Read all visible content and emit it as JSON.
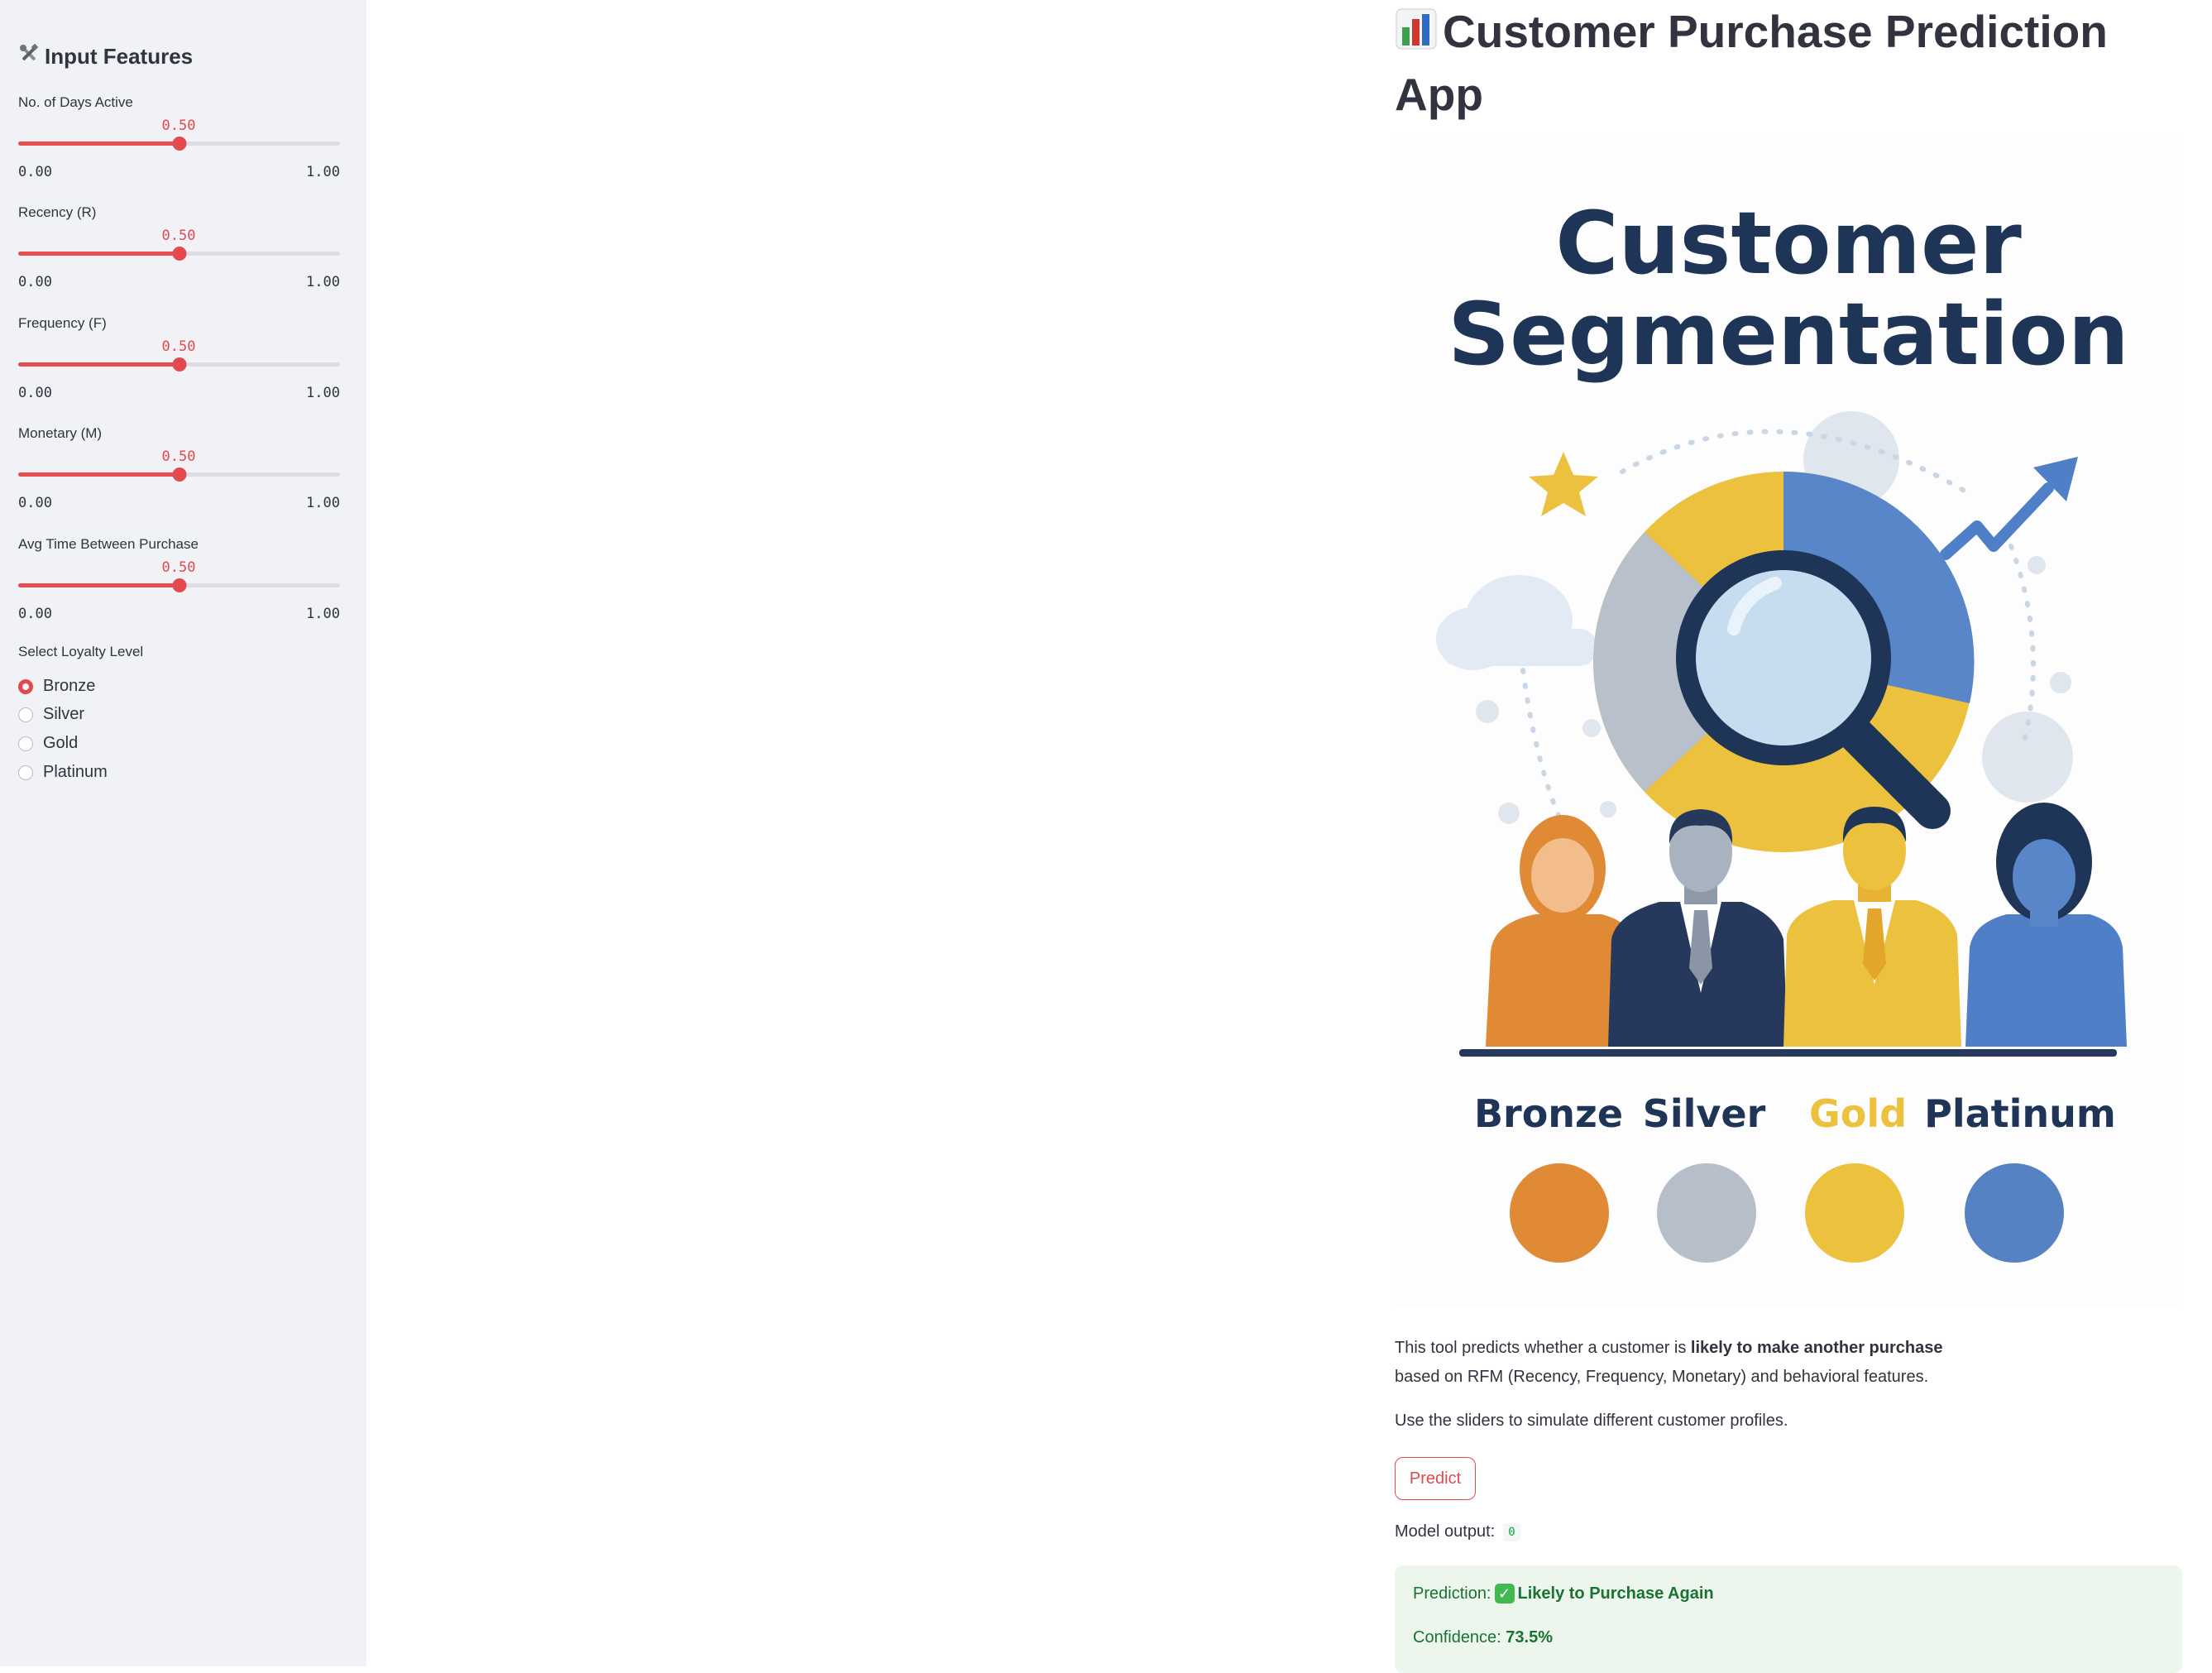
{
  "sidebar": {
    "title": "Input Features",
    "title_icon": "tools-icon",
    "sliders": [
      {
        "label": "No. of Days Active",
        "value": "0.50",
        "min": "0.00",
        "max": "1.00",
        "fraction": 0.5
      },
      {
        "label": "Recency (R)",
        "value": "0.50",
        "min": "0.00",
        "max": "1.00",
        "fraction": 0.5
      },
      {
        "label": "Frequency (F)",
        "value": "0.50",
        "min": "0.00",
        "max": "1.00",
        "fraction": 0.5
      },
      {
        "label": "Monetary (M)",
        "value": "0.50",
        "min": "0.00",
        "max": "1.00",
        "fraction": 0.5
      },
      {
        "label": "Avg Time Between Purchase",
        "value": "0.50",
        "min": "0.00",
        "max": "1.00",
        "fraction": 0.5
      }
    ],
    "radio": {
      "label": "Select Loyalty Level",
      "options": [
        "Bronze",
        "Silver",
        "Gold",
        "Platinum"
      ],
      "selected": "Bronze"
    }
  },
  "main": {
    "title_icon": "bar-chart-icon",
    "title": "Customer Purchase Prediction App",
    "hero": {
      "heading_line1": "Customer",
      "heading_line2": "Segmentation",
      "tiers": [
        "Bronze",
        "Silver",
        "Gold",
        "Platinum"
      ],
      "tier_colors": [
        "#e08a36",
        "#b5bec9",
        "#ecc13e",
        "#5682c4"
      ],
      "heading_color": "#1f3558"
    },
    "desc_part1": "This tool predicts whether a customer is ",
    "desc_bold": "likely to make another purchase",
    "desc_part2": "based on RFM (Recency, Frequency, Monetary) and behavioral features.",
    "desc2": "Use the sliders to simulate different customer profiles.",
    "predict_label": "Predict",
    "model_output_label": "Model output:",
    "model_output_value": "0",
    "prediction_label": "Prediction:",
    "prediction_value": "Likely to Purchase Again",
    "confidence_label": "Confidence:",
    "confidence_value": "73.5%"
  },
  "colors": {
    "accent": "#e3494d",
    "success_bg": "#edf6ec",
    "success_text": "#177233",
    "sidebar_bg": "#f0f2f6"
  }
}
